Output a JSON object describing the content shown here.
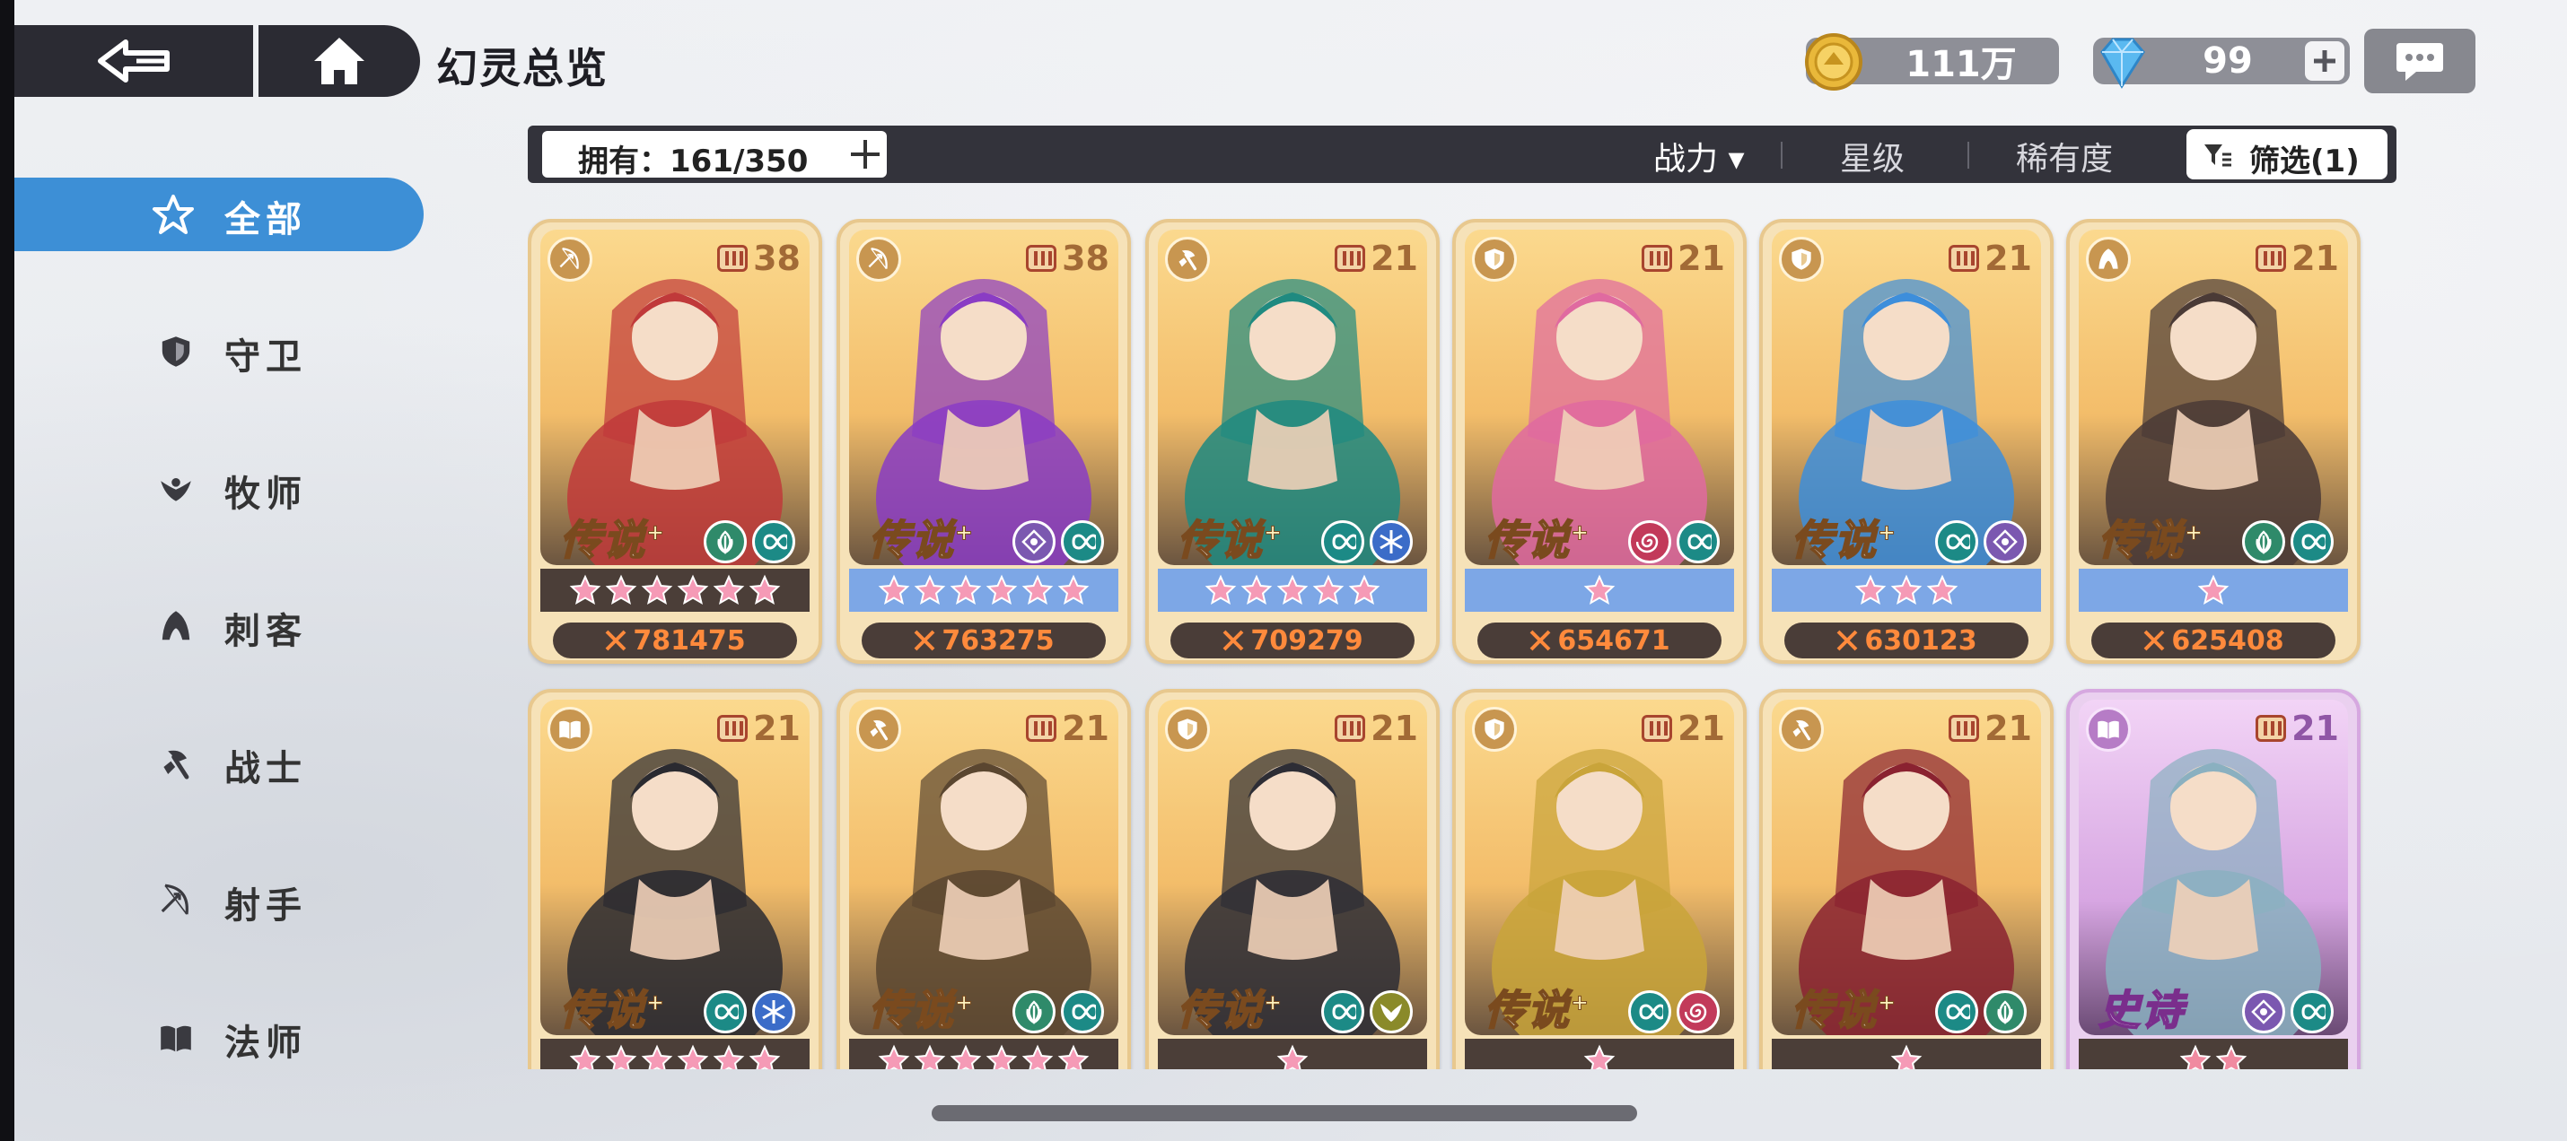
{
  "header": {
    "title": "幻灵总览",
    "gold": "111万",
    "gems": "99"
  },
  "sidebar": {
    "items": [
      {
        "label": "全部",
        "icon": "all-star-icon",
        "active": true
      },
      {
        "label": "守卫",
        "icon": "shield-icon",
        "active": false
      },
      {
        "label": "牧师",
        "icon": "wings-icon",
        "active": false
      },
      {
        "label": "刺客",
        "icon": "hood-icon",
        "active": false
      },
      {
        "label": "战士",
        "icon": "axe-icon",
        "active": false
      },
      {
        "label": "射手",
        "icon": "bow-icon",
        "active": false
      },
      {
        "label": "法师",
        "icon": "book-icon",
        "active": false
      }
    ]
  },
  "filterbar": {
    "owned": "拥有：161/350",
    "sort_power": "战力 ▾",
    "sort_star": "星级",
    "sort_rarity": "稀有度",
    "filter": "筛选(1)"
  },
  "cards": [
    {
      "level": "38",
      "rank": "传说",
      "class": "bow-icon",
      "elements": [
        "leaf",
        "infinity"
      ],
      "stars": 6,
      "star_bg": "dark",
      "power": "781475",
      "theme": "#c0393a"
    },
    {
      "level": "38",
      "rank": "传说",
      "class": "bow-icon",
      "elements": [
        "eye",
        "infinity"
      ],
      "stars": 6,
      "star_bg": "blue",
      "power": "763275",
      "theme": "#8a3cc4"
    },
    {
      "level": "21",
      "rank": "传说",
      "class": "axe-icon",
      "elements": [
        "infinity",
        "snow"
      ],
      "stars": 5,
      "star_bg": "blue",
      "power": "709279",
      "theme": "#1f8a80"
    },
    {
      "level": "21",
      "rank": "传说",
      "class": "shield-icon",
      "elements": [
        "swirl",
        "infinity"
      ],
      "stars": 1,
      "star_bg": "blue",
      "power": "654671",
      "theme": "#e06aa0"
    },
    {
      "level": "21",
      "rank": "传说",
      "class": "shield-icon",
      "elements": [
        "infinity",
        "eye"
      ],
      "stars": 3,
      "star_bg": "blue",
      "power": "630123",
      "theme": "#3d8edb"
    },
    {
      "level": "21",
      "rank": "传说",
      "class": "hood-icon",
      "elements": [
        "leaf",
        "infinity"
      ],
      "stars": 1,
      "star_bg": "blue",
      "power": "625408",
      "theme": "#4a3a36"
    },
    {
      "level": "21",
      "rank": "传说",
      "class": "book-icon",
      "elements": [
        "infinity",
        "snow"
      ],
      "stars": 6,
      "star_bg": "dark",
      "power": "",
      "theme": "#2a2a30"
    },
    {
      "level": "21",
      "rank": "传说",
      "class": "axe-icon",
      "elements": [
        "leaf",
        "infinity"
      ],
      "stars": 6,
      "star_bg": "dark",
      "power": "",
      "theme": "#5a4630"
    },
    {
      "level": "21",
      "rank": "传说",
      "class": "shield-icon",
      "elements": [
        "infinity",
        "wing"
      ],
      "stars": 1,
      "star_bg": "dark",
      "power": "",
      "theme": "#2d2d35"
    },
    {
      "level": "21",
      "rank": "传说",
      "class": "shield-icon",
      "elements": [
        "infinity",
        "swirl"
      ],
      "stars": 1,
      "star_bg": "dark",
      "power": "",
      "theme": "#c9a43a"
    },
    {
      "level": "21",
      "rank": "传说",
      "class": "axe-icon",
      "elements": [
        "infinity",
        "leaf"
      ],
      "stars": 1,
      "star_bg": "dark",
      "power": "",
      "theme": "#8a2230"
    },
    {
      "level": "21",
      "rank": "史诗",
      "class": "book-icon",
      "elements": [
        "eye",
        "infinity"
      ],
      "stars": 2,
      "star_bg": "dark",
      "power": "",
      "theme": "#8ab0c0",
      "epic": true
    }
  ]
}
